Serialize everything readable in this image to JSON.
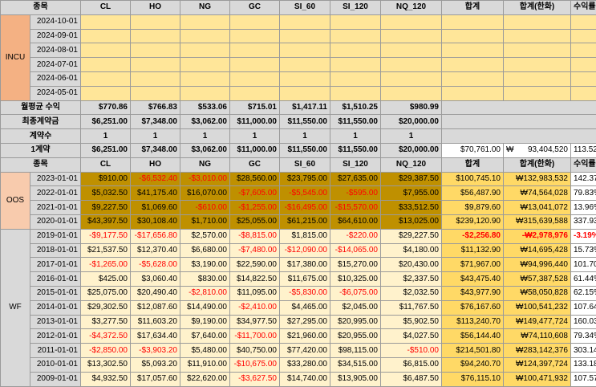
{
  "headers": [
    "종목",
    "CL",
    "HO",
    "NG",
    "GC",
    "SI_60",
    "SI_120",
    "NQ_120",
    "합계",
    "합계(한화)",
    "수익률"
  ],
  "incu": {
    "label": "INCU",
    "dates": [
      "2024-10-01",
      "2024-09-01",
      "2024-08-01",
      "2024-07-01",
      "2024-06-01",
      "2024-05-01"
    ]
  },
  "summary": {
    "monthly": {
      "label": "월평균 수익",
      "values": [
        "$770.86",
        "$766.83",
        "$533.06",
        "$715.01",
        "$1,417.11",
        "$1,510.25",
        "$980.99"
      ]
    },
    "final": {
      "label": "최종계약금",
      "values": [
        "$6,251.00",
        "$7,348.00",
        "$3,062.00",
        "$11,000.00",
        "$11,550.00",
        "$11,550.00",
        "$20,000.00"
      ]
    },
    "count": {
      "label": "계약수",
      "values": [
        "1",
        "1",
        "1",
        "1",
        "1",
        "1",
        "1"
      ]
    },
    "one": {
      "label": "1계약",
      "values": [
        "$6,251.00",
        "$7,348.00",
        "$3,062.00",
        "$11,000.00",
        "$11,550.00",
        "$11,550.00",
        "$20,000.00"
      ],
      "total": "$70,761.00",
      "won_symbol": "₩",
      "won_value": "93,404,520",
      "rate": "113.52%"
    }
  },
  "oos": {
    "label": "OOS",
    "rows": [
      {
        "date": "2023-01-01",
        "values": [
          "$910.00",
          "-$6,532.40",
          "-$3,010.00",
          "$28,560.00",
          "$23,795.00",
          "$27,635.00",
          "$29,387.50"
        ],
        "total": "$100,745.10",
        "won": "₩132,983,532",
        "rate": "142.37%"
      },
      {
        "date": "2022-01-01",
        "values": [
          "$5,032.50",
          "$41,175.40",
          "$16,070.00",
          "-$7,605.00",
          "-$5,545.00",
          "-$595.00",
          "$7,955.00"
        ],
        "total": "$56,487.90",
        "won": "₩74,564,028",
        "rate": "79.83%"
      },
      {
        "date": "2021-01-01",
        "values": [
          "$9,227.50",
          "$1,069.60",
          "-$610.00",
          "-$1,255.00",
          "-$16,495.00",
          "-$15,570.00",
          "$33,512.50"
        ],
        "total": "$9,879.60",
        "won": "₩13,041,072",
        "rate": "13.96%"
      },
      {
        "date": "2020-01-01",
        "values": [
          "$43,397.50",
          "$30,108.40",
          "$1,710.00",
          "$25,055.00",
          "$61,215.00",
          "$64,610.00",
          "$13,025.00"
        ],
        "total": "$239,120.90",
        "won": "₩315,639,588",
        "rate": "337.93%"
      }
    ]
  },
  "wf": {
    "label": "WF",
    "rows": [
      {
        "date": "2019-01-01",
        "values": [
          "-$9,177.50",
          "-$17,656.80",
          "$2,570.00",
          "-$8,815.00",
          "$1,815.00",
          "-$220.00",
          "$29,227.50"
        ],
        "total": "-$2,256.80",
        "won": "-₩2,978,976",
        "rate": "-3.19%"
      },
      {
        "date": "2018-01-01",
        "values": [
          "$21,537.50",
          "$12,370.40",
          "$6,680.00",
          "-$7,480.00",
          "-$12,090.00",
          "-$14,065.00",
          "$4,180.00"
        ],
        "total": "$11,132.90",
        "won": "₩14,695,428",
        "rate": "15.73%"
      },
      {
        "date": "2017-01-01",
        "values": [
          "-$1,265.00",
          "-$5,628.00",
          "$3,190.00",
          "$22,590.00",
          "$17,380.00",
          "$15,270.00",
          "$20,430.00"
        ],
        "total": "$71,967.00",
        "won": "₩94,996,440",
        "rate": "101.70%"
      },
      {
        "date": "2016-01-01",
        "values": [
          "$425.00",
          "$3,060.40",
          "$830.00",
          "$14,822.50",
          "$11,675.00",
          "$10,325.00",
          "$2,337.50"
        ],
        "total": "$43,475.40",
        "won": "₩57,387,528",
        "rate": "61.44%"
      },
      {
        "date": "2015-01-01",
        "values": [
          "$25,075.00",
          "$20,490.40",
          "-$2,810.00",
          "$11,095.00",
          "-$5,830.00",
          "-$6,075.00",
          "$2,032.50"
        ],
        "total": "$43,977.90",
        "won": "₩58,050,828",
        "rate": "62.15%"
      },
      {
        "date": "2014-01-01",
        "values": [
          "$29,302.50",
          "$12,087.60",
          "$14,490.00",
          "-$2,410.00",
          "$4,465.00",
          "$2,045.00",
          "$11,767.50"
        ],
        "total": "$76,167.60",
        "won": "₩100,541,232",
        "rate": "107.64%"
      },
      {
        "date": "2013-01-01",
        "values": [
          "$3,277.50",
          "$11,603.20",
          "$9,190.00",
          "$34,977.50",
          "$27,295.00",
          "$20,995.00",
          "$5,902.50"
        ],
        "total": "$113,240.70",
        "won": "₩149,477,724",
        "rate": "160.03%"
      },
      {
        "date": "2012-01-01",
        "values": [
          "-$4,372.50",
          "$17,634.40",
          "$7,640.00",
          "-$11,700.00",
          "$21,960.00",
          "$20,955.00",
          "$4,027.50"
        ],
        "total": "$56,144.40",
        "won": "₩74,110,608",
        "rate": "79.34%"
      },
      {
        "date": "2011-01-01",
        "values": [
          "-$2,850.00",
          "-$3,903.20",
          "$5,480.00",
          "$40,750.00",
          "$77,420.00",
          "$98,115.00",
          "-$510.00"
        ],
        "total": "$214,501.80",
        "won": "₩283,142,376",
        "rate": "303.14%"
      },
      {
        "date": "2010-01-01",
        "values": [
          "$13,302.50",
          "$5,093.20",
          "$11,910.00",
          "-$10,675.00",
          "$33,280.00",
          "$34,515.00",
          "$6,815.00"
        ],
        "total": "$94,240.70",
        "won": "₩124,397,724",
        "rate": "133.18%"
      },
      {
        "date": "2009-01-01",
        "values": [
          "$4,932.50",
          "$17,057.60",
          "$22,620.00",
          "-$3,627.50",
          "$14,740.00",
          "$13,905.00",
          "$6,487.50"
        ],
        "total": "$76,115.10",
        "won": "₩100,471,932",
        "rate": "107.57%"
      }
    ]
  },
  "colors": {
    "incu_label": "#f4b183",
    "oos_label": "#f8cbad",
    "yellow": "#ffe699",
    "gold": "#bf9000",
    "cream": "#fff2cc",
    "total": "#ffd966",
    "header": "#d9d9d9",
    "negative": "#ff0000"
  }
}
